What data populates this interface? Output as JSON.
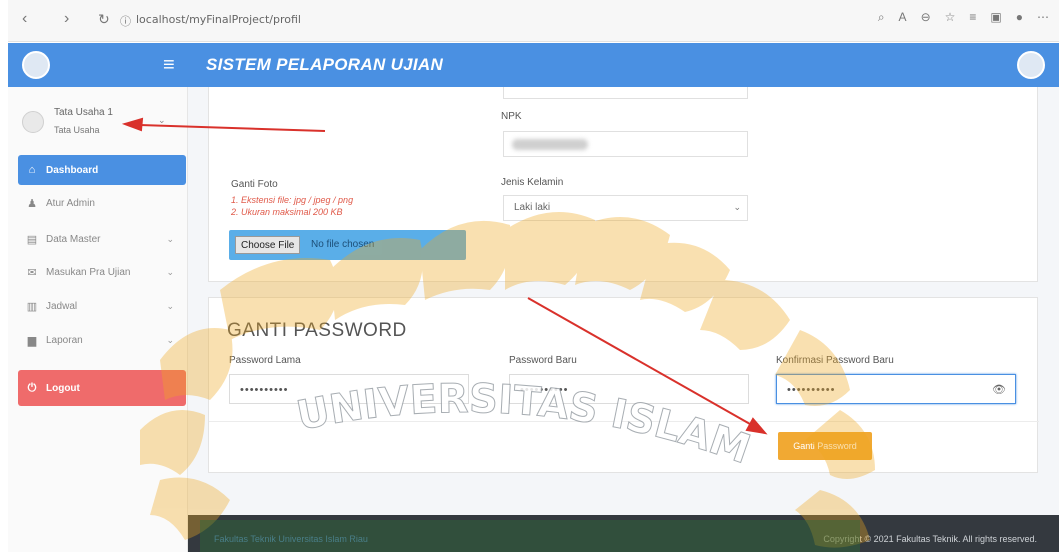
{
  "browser": {
    "url": "localhost/myFinalProject/profil",
    "back_icon": "chevron-left-icon",
    "forward_icon": "chevron-right-icon",
    "reload_icon": "reload-icon",
    "info_icon": "info-icon"
  },
  "header": {
    "title": "SISTEM PELAPORAN UJIAN",
    "menu_icon": "hamburger-icon",
    "color": "#4a90e2"
  },
  "sidebar": {
    "user": {
      "name": "Tata Usaha 1",
      "role": "Tata Usaha"
    },
    "items": [
      {
        "label": "Dashboard",
        "icon": "home-icon",
        "active": true,
        "caret": false
      },
      {
        "label": "Atur Admin",
        "icon": "user-icon",
        "active": false,
        "caret": false
      },
      {
        "label": "Data Master",
        "icon": "list-icon",
        "active": false,
        "caret": true
      },
      {
        "label": "Masukan Pra Ujian",
        "icon": "mail-icon",
        "active": false,
        "caret": true
      },
      {
        "label": "Jadwal",
        "icon": "columns-icon",
        "active": false,
        "caret": true
      },
      {
        "label": "Laporan",
        "icon": "file-icon",
        "active": false,
        "caret": true
      }
    ],
    "logout": {
      "label": "Logout",
      "icon": "power-icon",
      "color": "#ef6b6b"
    }
  },
  "profile_form": {
    "foto_label": "Ganti Foto",
    "foto_note_1": "1. Ekstensi file: jpg / jpeg / png",
    "foto_note_2": "2. Ukuran maksimal 200 KB",
    "file_button": "Choose File",
    "file_status": "No file chosen",
    "npk_label": "NPK",
    "jenis_kelamin_label": "Jenis Kelamin",
    "jenis_kelamin_value": "Laki laki"
  },
  "password_form": {
    "title": "GANTI PASSWORD",
    "old_label": "Password Lama",
    "old_value": "••••••••••",
    "new_label": "Password Baru",
    "new_value": "••••••••••",
    "confirm_label": "Konfirmasi Password Baru",
    "confirm_value": "••••••••••",
    "submit_label": "Ganti Password",
    "submit_color": "#f1a933"
  },
  "footer": {
    "left": "Fakultas Teknik Universitas Islam Riau",
    "right": "Copyright © 2021 Fakultas Teknik. All rights reserved."
  },
  "watermark": {
    "text": "UNIVERSITAS ISLAM RIAU"
  },
  "annotation_color": "#d9312b"
}
